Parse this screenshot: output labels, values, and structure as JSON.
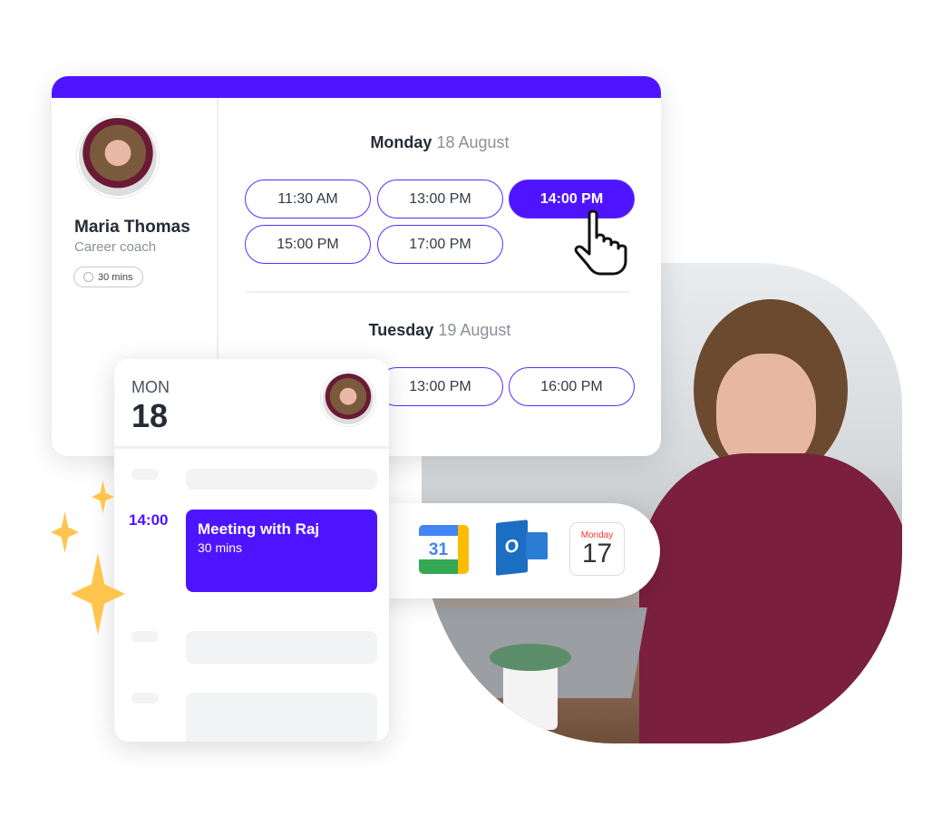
{
  "host": {
    "name": "Maria Thomas",
    "role": "Career coach",
    "duration": "30 mins"
  },
  "days": [
    {
      "weekday": "Monday",
      "date": "18 August",
      "slots": [
        {
          "time": "11:30 AM",
          "selected": false
        },
        {
          "time": "13:00 PM",
          "selected": false
        },
        {
          "time": "14:00 PM",
          "selected": true
        },
        {
          "time": "15:00 PM",
          "selected": false
        },
        {
          "time": "17:00 PM",
          "selected": false
        }
      ]
    },
    {
      "weekday": "Tuesday",
      "date": "19 August",
      "slots": [
        {
          "time": "13:00 PM",
          "selected": false
        },
        {
          "time": "16:00 PM",
          "selected": false
        }
      ]
    }
  ],
  "calendar": {
    "weekday": "MON",
    "day": "18",
    "event_time": "14:00",
    "event_title": "Meeting with Raj",
    "event_duration": "30 mins"
  },
  "integrations": [
    {
      "name": "google-calendar",
      "label": "31"
    },
    {
      "name": "outlook",
      "label": "O"
    },
    {
      "name": "apple-calendar",
      "weekday": "Monday",
      "day": "17"
    }
  ],
  "colors": {
    "accent": "#4f14ff",
    "sparkle": "#ffc54d"
  }
}
